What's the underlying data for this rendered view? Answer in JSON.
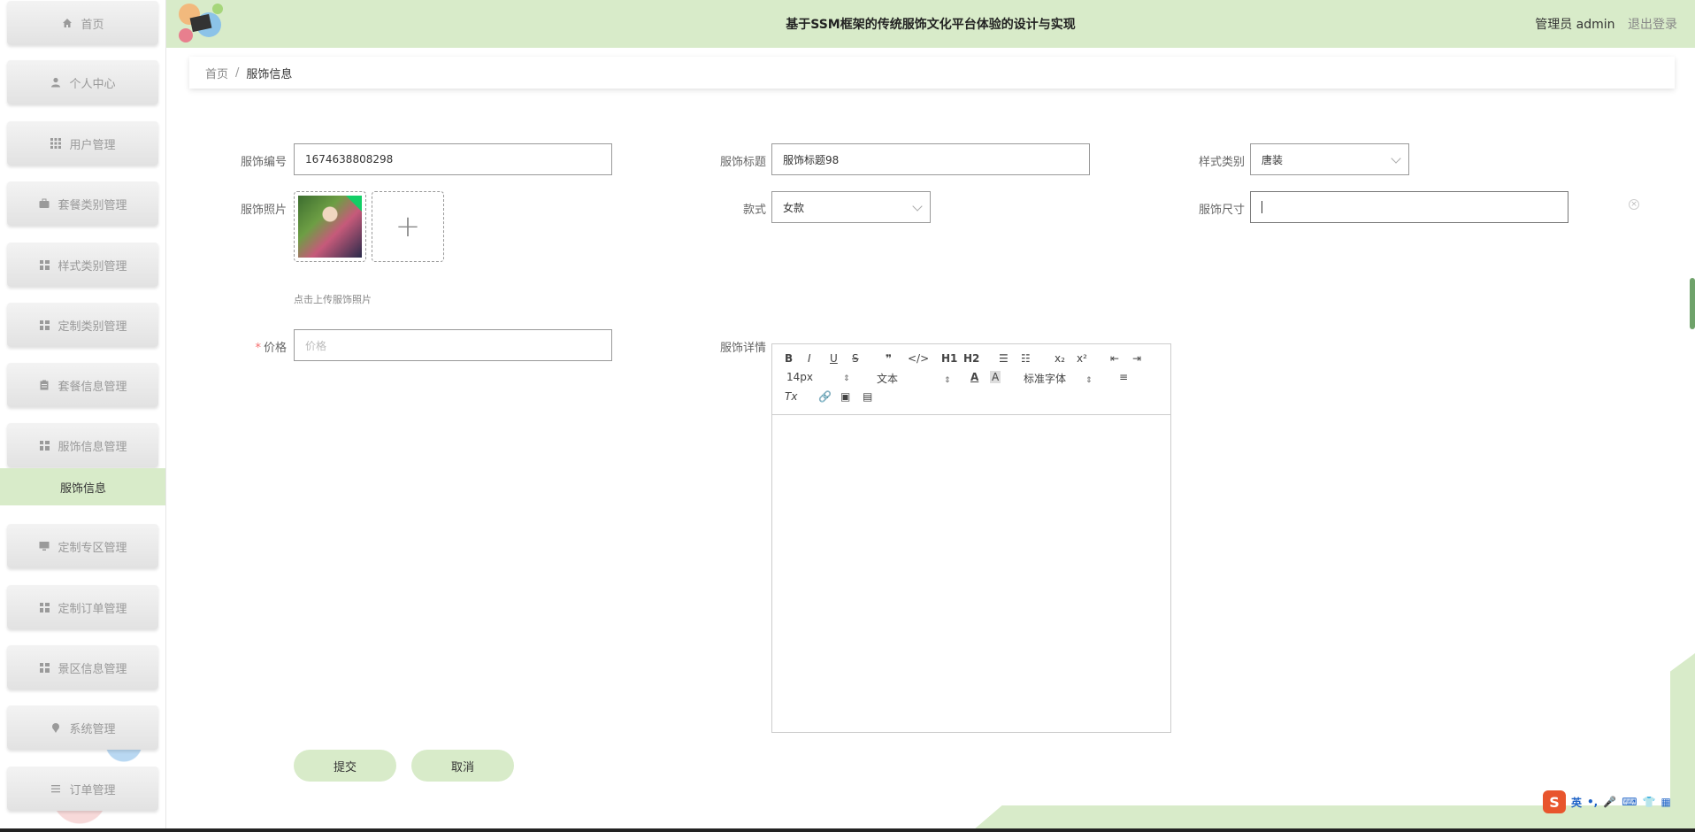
{
  "header": {
    "title": "基于SSM框架的传统服饰文化平台体验的设计与实现",
    "user_role": "管理员 admin",
    "logout": "退出登录"
  },
  "sidebar": {
    "items": [
      {
        "label": "首页",
        "icon": "home-icon"
      },
      {
        "label": "个人中心",
        "icon": "user-icon"
      },
      {
        "label": "用户管理",
        "icon": "grid-icon"
      },
      {
        "label": "套餐类别管理",
        "icon": "briefcase-icon"
      },
      {
        "label": "样式类别管理",
        "icon": "grid-icon"
      },
      {
        "label": "定制类别管理",
        "icon": "grid-icon"
      },
      {
        "label": "套餐信息管理",
        "icon": "clipboard-icon"
      },
      {
        "label": "服饰信息管理",
        "icon": "grid-icon"
      },
      {
        "label": "定制专区管理",
        "icon": "monitor-icon"
      },
      {
        "label": "定制订单管理",
        "icon": "grid-icon"
      },
      {
        "label": "景区信息管理",
        "icon": "grid-icon"
      },
      {
        "label": "系统管理",
        "icon": "pin-icon"
      },
      {
        "label": "订单管理",
        "icon": "list-icon"
      }
    ],
    "active_sub": "服饰信息"
  },
  "breadcrumb": {
    "home": "首页",
    "separator": "/",
    "current": "服饰信息"
  },
  "form": {
    "code_label": "服饰编号",
    "code_value": "1674638808298",
    "title_label": "服饰标题",
    "title_value": "服饰标题98",
    "style_label": "样式类别",
    "style_value": "唐装",
    "photo_label": "服饰照片",
    "upload_plus": "+",
    "upload_tip": "点击上传服饰照片",
    "kind_label": "款式",
    "kind_value": "女款",
    "size_label": "服饰尺寸",
    "price_label": "价格",
    "price_required": "*",
    "price_placeholder": "价格",
    "detail_label": "服饰详情",
    "clear_mark": "×"
  },
  "editor": {
    "bold": "B",
    "italic": "I",
    "underline": "U",
    "strike": "S",
    "quote": "❞",
    "code": "</>",
    "h1": "H1",
    "h2": "H2",
    "ol": "☰",
    "ul": "☷",
    "sub": "x₂",
    "sup": "x²",
    "outdent": "⇤",
    "indent": "⇥",
    "size": "14px",
    "format": "文本",
    "font_color": "A",
    "bg_color": "A",
    "font": "标准字体",
    "align": "≡",
    "clean": "Tx",
    "link": "🔗",
    "image": "▣",
    "video": "▤",
    "picker_arrow": "⇕"
  },
  "buttons": {
    "submit": "提交",
    "cancel": "取消"
  },
  "ime": {
    "logo": "S",
    "lang": "英",
    "punct": "•,",
    "voice": "🎤",
    "keyboard": "⌨",
    "skin": "👕",
    "menu": "▦"
  }
}
